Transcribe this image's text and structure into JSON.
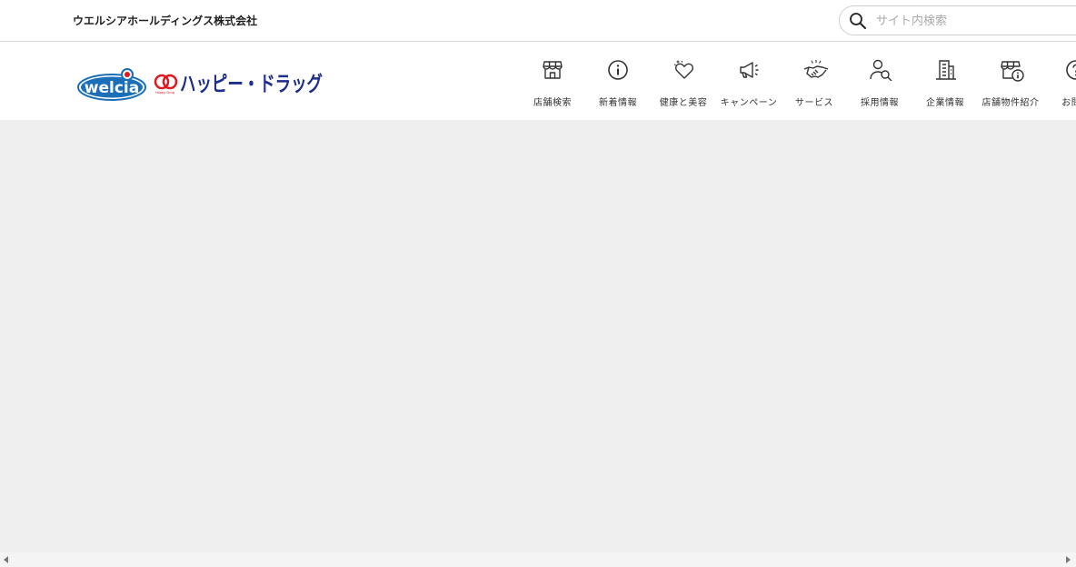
{
  "topbar": {
    "corp_name": "ウエルシアホールディングス株式会社",
    "search_placeholder": "サイト内検索",
    "search_icon": "search-icon"
  },
  "brand": {
    "welcia_text": "welcia",
    "happy_text": "ハッピー・ドラッグ",
    "happy_sub": "Happy Drug",
    "colors": {
      "welcia_blue": "#1a6fb8",
      "happy_red": "#e2161f",
      "happy_navy": "#1c2d8a"
    }
  },
  "nav": {
    "items": [
      {
        "label": "店舗検索",
        "icon": "store-icon"
      },
      {
        "label": "新着情報",
        "icon": "info-icon"
      },
      {
        "label": "健康と美容",
        "icon": "heart-sparkle-icon"
      },
      {
        "label": "キャンペーン",
        "icon": "megaphone-icon"
      },
      {
        "label": "サービス",
        "icon": "handshake-icon"
      },
      {
        "label": "採用情報",
        "icon": "person-search-icon"
      },
      {
        "label": "企業情報",
        "icon": "building-icon"
      },
      {
        "label": "店舗物件紹介",
        "icon": "store-info-icon"
      },
      {
        "label": "お問い",
        "icon": "question-icon"
      }
    ]
  }
}
